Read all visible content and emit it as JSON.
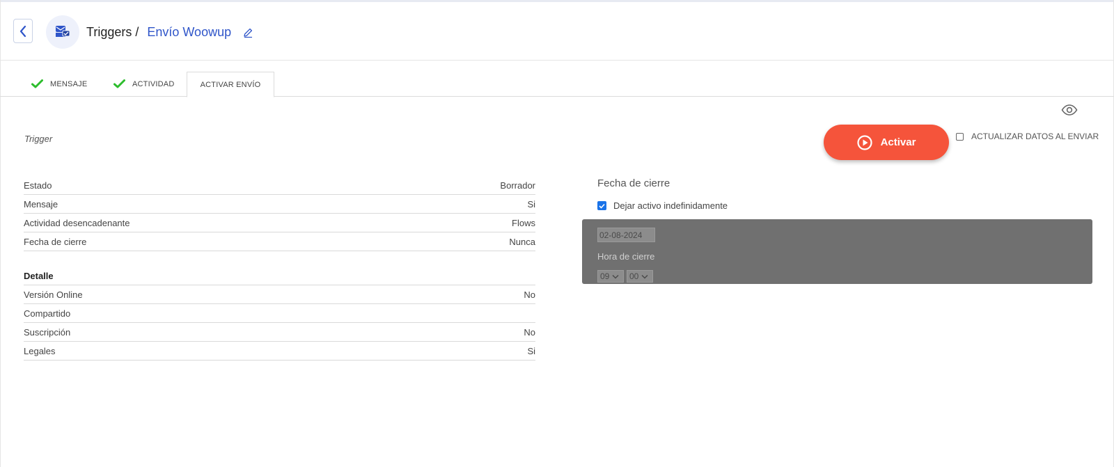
{
  "header": {
    "section": "Triggers /",
    "campaign_name": "Envío Woowup"
  },
  "tabs": [
    {
      "label": "MENSAJE",
      "done": true
    },
    {
      "label": "ACTIVIDAD",
      "done": true
    },
    {
      "label": "ACTIVAR ENVÍO",
      "active": true
    }
  ],
  "trigger_label": "Trigger",
  "activate_button": "Activar",
  "update_checkbox": {
    "label": "ACTUALIZAR DATOS AL ENVIAR",
    "checked": false
  },
  "summary": [
    {
      "label": "Estado",
      "value": "Borrador"
    },
    {
      "label": "Mensaje",
      "value": "Si"
    },
    {
      "label": "Actividad desencadenante",
      "value": "Flows"
    },
    {
      "label": "Fecha de cierre",
      "value": "Nunca"
    }
  ],
  "detail": {
    "title": "Detalle",
    "rows": [
      {
        "label": "Versión Online",
        "value": "No"
      },
      {
        "label": "Compartido",
        "value": ""
      },
      {
        "label": "Suscripción",
        "value": "No"
      },
      {
        "label": "Legales",
        "value": "Si"
      }
    ]
  },
  "closing": {
    "title": "Fecha de cierre",
    "indefinite_label": "Dejar activo indefinidamente",
    "indefinite_checked": true,
    "date_value": "02-08-2024",
    "time_label": "Hora de cierre",
    "hour": "09",
    "minute": "00"
  },
  "colors": {
    "accent_blue": "#2f55c9",
    "activate_red": "#f5543b",
    "check_green": "#2dbd2d",
    "disabled_panel": "#707070"
  }
}
